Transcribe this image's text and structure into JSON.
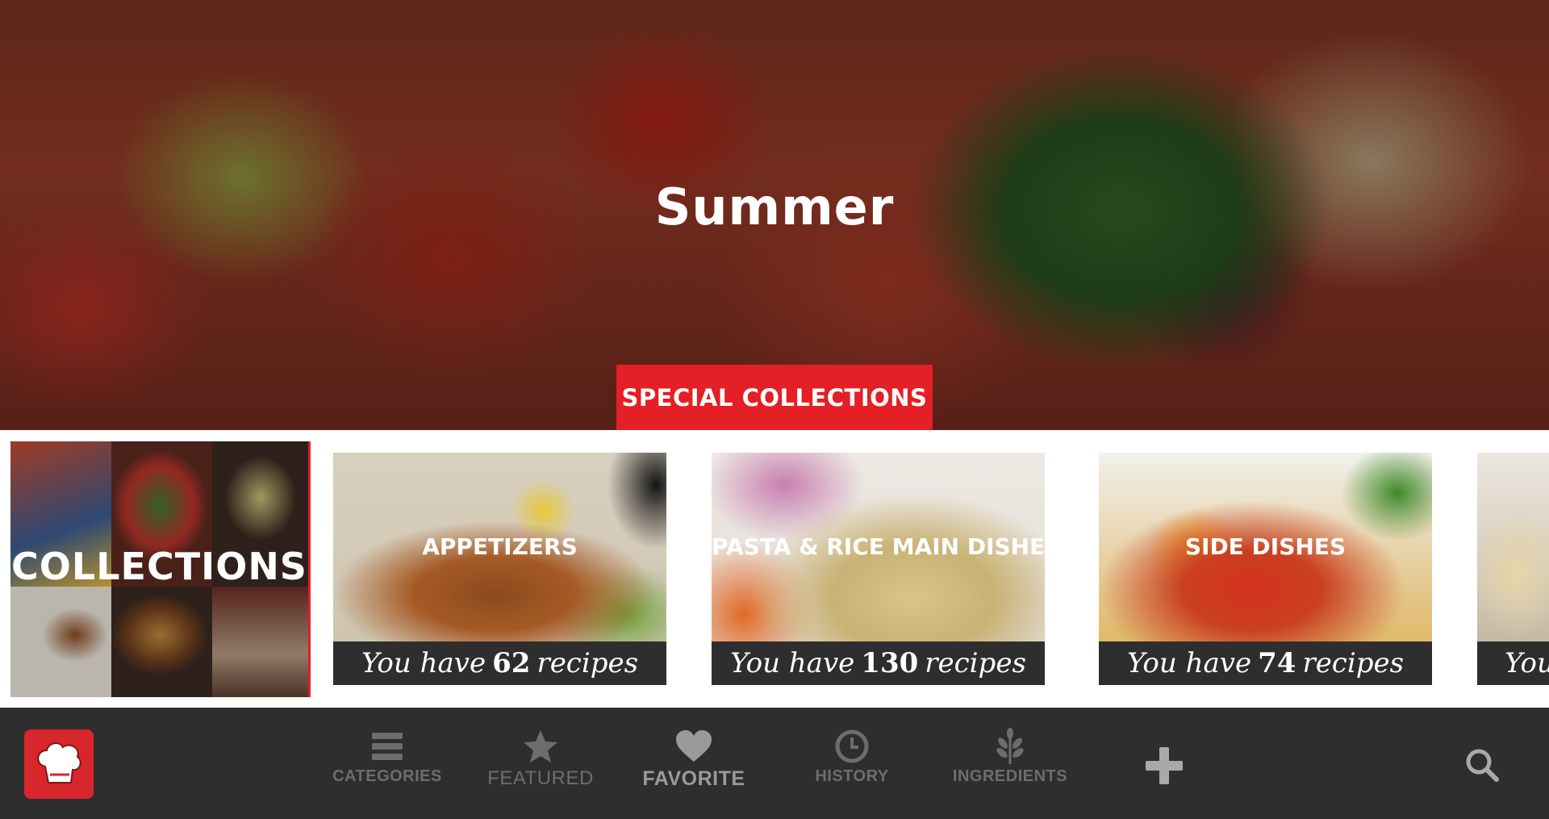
{
  "hero": {
    "title": "Summer",
    "button_label": "SPECIAL COLLECTIONS"
  },
  "collections_card": {
    "label": "COLLECTIONS"
  },
  "categories": [
    {
      "name": "APPETIZERS",
      "count_prefix": "You have",
      "count": "62",
      "count_suffix": "recipes"
    },
    {
      "name": "PASTA & RICE MAIN DISHES",
      "count_prefix": "You have",
      "count": "130",
      "count_suffix": "recipes"
    },
    {
      "name": "SIDE DISHES",
      "count_prefix": "You have",
      "count": "74",
      "count_suffix": "recipes"
    },
    {
      "name": "",
      "count_prefix": "You",
      "count": "",
      "count_suffix": ""
    }
  ],
  "nav": {
    "categories_label": "CATEGORIES",
    "featured_label": "FEATURED",
    "favorite_label": "FAVORITE",
    "history_label": "HISTORY",
    "ingredients_label": "INGREDIENTS"
  },
  "icons": {
    "logo": "chef-hat-icon",
    "categories": "list-icon",
    "featured": "star-icon",
    "favorite": "heart-icon",
    "history": "clock-icon",
    "ingredients": "herb-icon",
    "add": "plus-icon",
    "search": "search-icon"
  },
  "colors": {
    "accent": "#e41f25",
    "nav_bg": "#2e2e2e",
    "nav_icon": "#6d6d6d",
    "nav_icon_active": "#9a9a9a"
  }
}
